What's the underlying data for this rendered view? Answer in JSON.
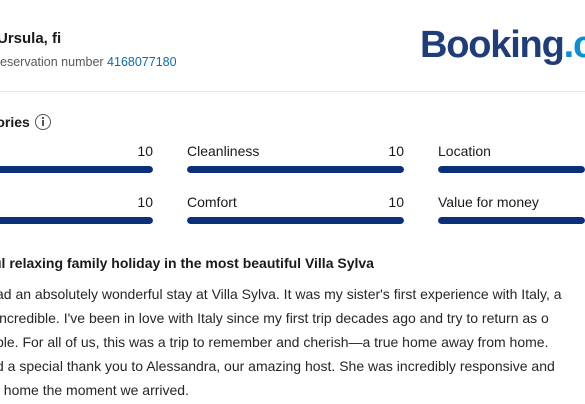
{
  "reviewer": {
    "name": "Ursula, fi",
    "reservation_label": "Reservation number",
    "reservation_number": "4168077180"
  },
  "logo": {
    "part1": "Booking",
    "part2": ".c"
  },
  "categories": {
    "title": "egories",
    "items": [
      {
        "label": "",
        "score": "10",
        "fraction": 1.0
      },
      {
        "label": "Cleanliness",
        "score": "10",
        "fraction": 1.0
      },
      {
        "label": "Location",
        "score": "",
        "fraction": 1.0
      },
      {
        "label": "",
        "score": "10",
        "fraction": 1.0
      },
      {
        "label": "Comfort",
        "score": "10",
        "fraction": 1.0
      },
      {
        "label": "Value for money",
        "score": "",
        "fraction": 1.0
      }
    ]
  },
  "review": {
    "title": "ul relaxing family holiday in the most beautiful Villa Sylva",
    "lines": [
      "ad an absolutely wonderful stay at Villa Sylva. It was my sister's first experience with Italy, a",
      "incredible. I've been in love with Italy since my first trip decades ago and try to return as o",
      "ble. For all of us, this was a trip to remember and cherish—a true home away from home.",
      "d a special thank you to Alessandra, our amazing host. She was incredibly responsive and",
      "t home the moment we arrived."
    ]
  }
}
